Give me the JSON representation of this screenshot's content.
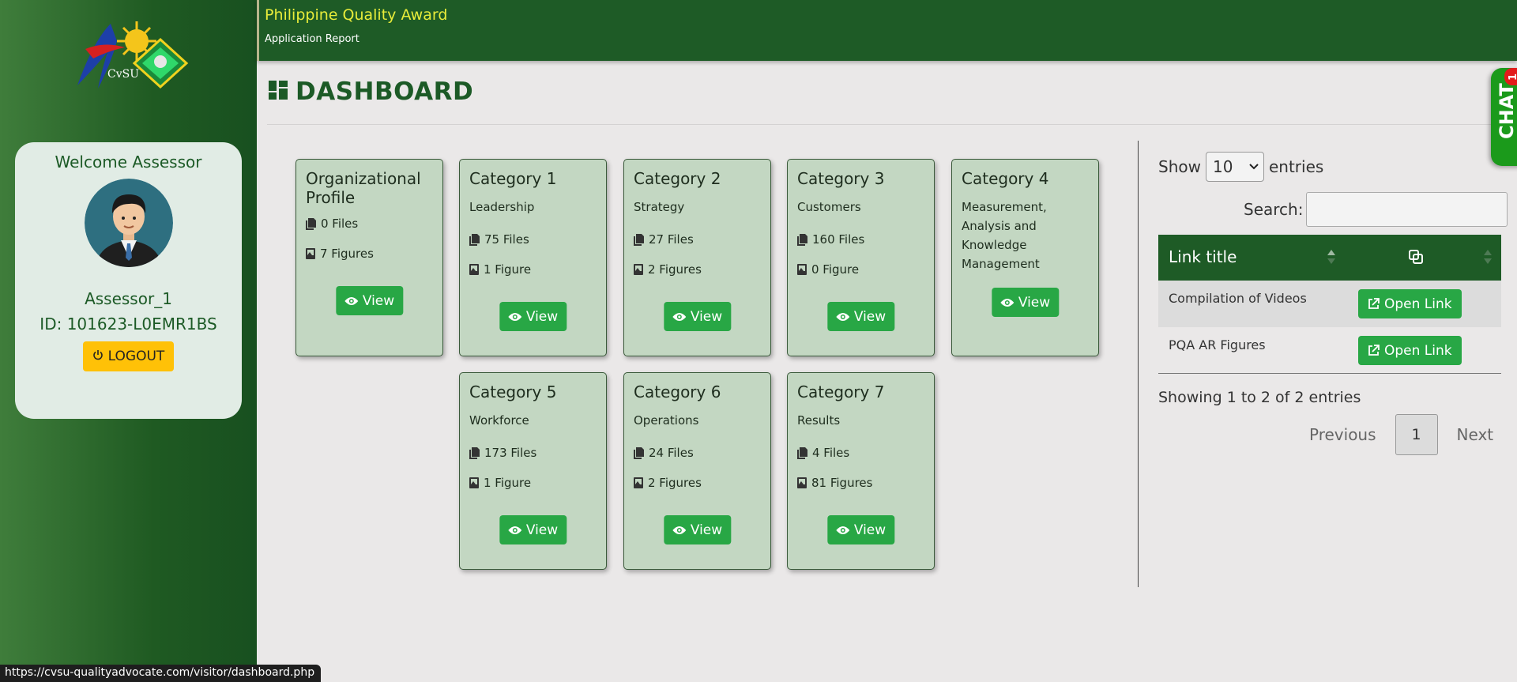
{
  "header": {
    "title": "Philippine Quality Award",
    "subtitle": "Application Report"
  },
  "sidebar": {
    "logo_text": "CvSU",
    "welcome": "Welcome Assessor",
    "user_name": "Assessor_1",
    "user_id": "ID: 101623-L0EMR1BS",
    "logout_label": "LOGOUT"
  },
  "page": {
    "title": "DASHBOARD"
  },
  "cards": [
    {
      "title": "Organizational Profile",
      "subtitle": "",
      "files": "0 Files",
      "figures": "7 Figures",
      "view_label": "View"
    },
    {
      "title": "Category 1",
      "subtitle": "Leadership",
      "files": "75 Files",
      "figures": "1 Figure",
      "view_label": "View"
    },
    {
      "title": "Category 2",
      "subtitle": "Strategy",
      "files": "27 Files",
      "figures": "2 Figures",
      "view_label": "View"
    },
    {
      "title": "Category 3",
      "subtitle": "Customers",
      "files": "160 Files",
      "figures": "0 Figure",
      "view_label": "View"
    },
    {
      "title": "Category 4",
      "subtitle": "Measurement, Analysis and Knowledge Management",
      "files": "",
      "figures": "",
      "view_label": "View"
    },
    {
      "title": "Category 5",
      "subtitle": "Workforce",
      "files": "173 Files",
      "figures": "1 Figure",
      "view_label": "View"
    },
    {
      "title": "Category 6",
      "subtitle": "Operations",
      "files": "24 Files",
      "figures": "2 Figures",
      "view_label": "View"
    },
    {
      "title": "Category 7",
      "subtitle": "Results",
      "files": "4 Files",
      "figures": "81 Figures",
      "view_label": "View"
    }
  ],
  "links_table": {
    "show_label": "Show",
    "entries_label": "entries",
    "page_size": "10",
    "search_label": "Search:",
    "search_value": "",
    "column_title": "Link title",
    "rows": [
      {
        "title": "Compilation of Videos",
        "action": "Open Link"
      },
      {
        "title": "PQA AR Figures",
        "action": "Open Link"
      }
    ],
    "info": "Showing 1 to 2 of 2 entries",
    "prev_label": "Previous",
    "current_page": "1",
    "next_label": "Next"
  },
  "chat": {
    "label": "CHAT",
    "badge": "1"
  },
  "status_url": "https://cvsu-qualityadvocate.com/visitor/dashboard.php",
  "colors": {
    "brand_green": "#1e5b26",
    "button_green": "#28a745",
    "card_bg": "#c3d7c2",
    "logout_yellow": "#ffc107",
    "title_yellow": "#e8ec3a"
  }
}
